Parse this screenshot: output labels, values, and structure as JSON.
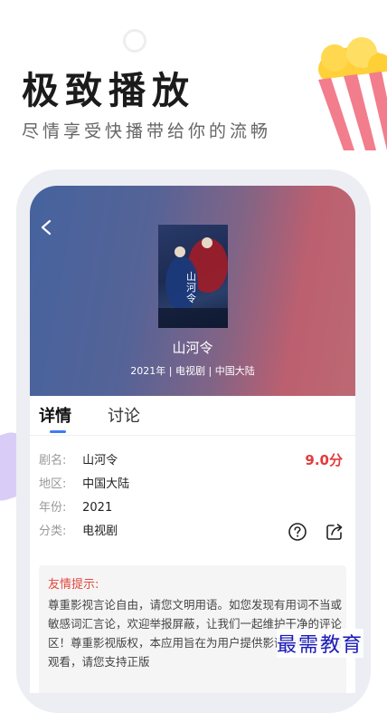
{
  "promo": {
    "headline": "极致播放",
    "subheadline": "尽情享受快播带给你的流畅"
  },
  "detail": {
    "title": "山河令",
    "meta": "2021年 | 电视剧 | 中国大陆",
    "poster_text": "山河令"
  },
  "tabs": [
    {
      "label": "详情",
      "active": true
    },
    {
      "label": "讨论",
      "active": false
    }
  ],
  "info": {
    "rows": [
      {
        "label": "剧名:",
        "value": "山河令"
      },
      {
        "label": "地区:",
        "value": "中国大陆"
      },
      {
        "label": "年份:",
        "value": "2021"
      },
      {
        "label": "分类:",
        "value": "电视剧"
      }
    ],
    "score": "9.0分"
  },
  "tip": {
    "title": "友情提示:",
    "body": "尊重影视言论自由，请您文明用语。如您发现有用词不当或敏感词汇言论，欢迎举报屏蔽，让我们一起维护干净的评论区！尊重影视版权，本应用旨在为用户提供影评指南，如需观看，请您支持正版"
  },
  "watermark": "最需教育",
  "colors": {
    "accent": "#3f7cf4",
    "score": "#e33b3b",
    "tip_title": "#e2483d"
  }
}
